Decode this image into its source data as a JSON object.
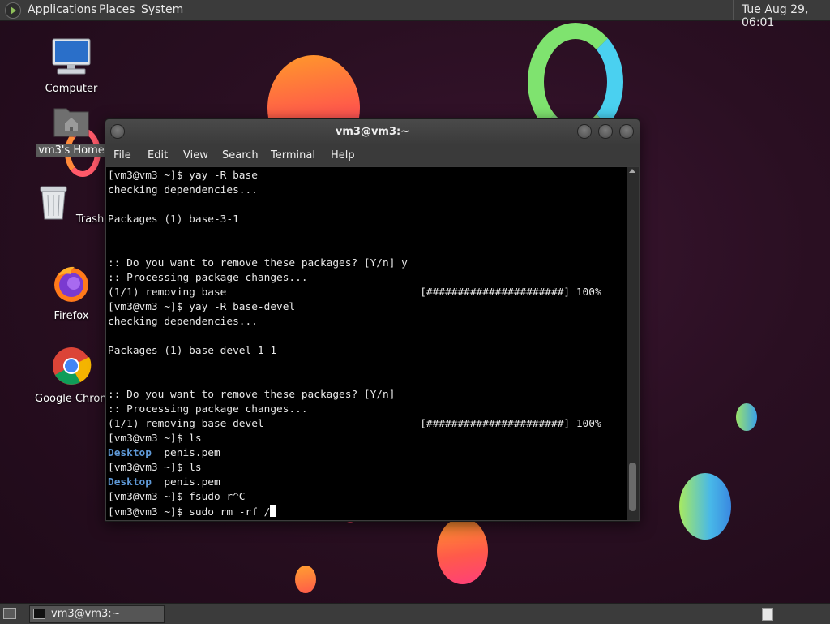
{
  "top_panel": {
    "menus": [
      "Applications",
      "Places",
      "System"
    ],
    "clock": "Tue Aug 29, 06:01"
  },
  "desktop_icons": [
    {
      "label": "Computer",
      "icon": "computer-icon"
    },
    {
      "label": "vm3's Home",
      "icon": "home-folder-icon"
    },
    {
      "label": "Trash",
      "icon": "trash-icon"
    },
    {
      "label": "Firefox",
      "icon": "firefox-icon"
    },
    {
      "label": "Google Chrom",
      "icon": "chrome-icon"
    }
  ],
  "window": {
    "title": "vm3@vm3:~",
    "menu": [
      "File",
      "Edit",
      "View",
      "Search",
      "Terminal",
      "Help"
    ]
  },
  "terminal": {
    "lines": [
      "[vm3@vm3 ~]$ yay -R base",
      "checking dependencies...",
      "",
      "Packages (1) base-3-1",
      "",
      "",
      ":: Do you want to remove these packages? [Y/n] y",
      ":: Processing package changes...",
      "(1/1) removing base                               [######################] 100%",
      "[vm3@vm3 ~]$ yay -R base-devel",
      "checking dependencies...",
      "",
      "Packages (1) base-devel-1-1",
      "",
      "",
      ":: Do you want to remove these packages? [Y/n]",
      ":: Processing package changes...",
      "(1/1) removing base-devel                         [######################] 100%",
      "[vm3@vm3 ~]$ ls",
      "",
      "[vm3@vm3 ~]$ ls",
      "",
      "[vm3@vm3 ~]$ fsudo r^C",
      "[vm3@vm3 ~]$ sudo rm -rf /"
    ],
    "ls_output": {
      "dir": "Desktop",
      "file": "  penis.pem"
    }
  },
  "taskbar": {
    "task_label": "vm3@vm3:~"
  },
  "colors": {
    "terminal_bg": "#000000",
    "directory_blue": "#5e98d6",
    "panel_bg": "#3b3b3b"
  }
}
